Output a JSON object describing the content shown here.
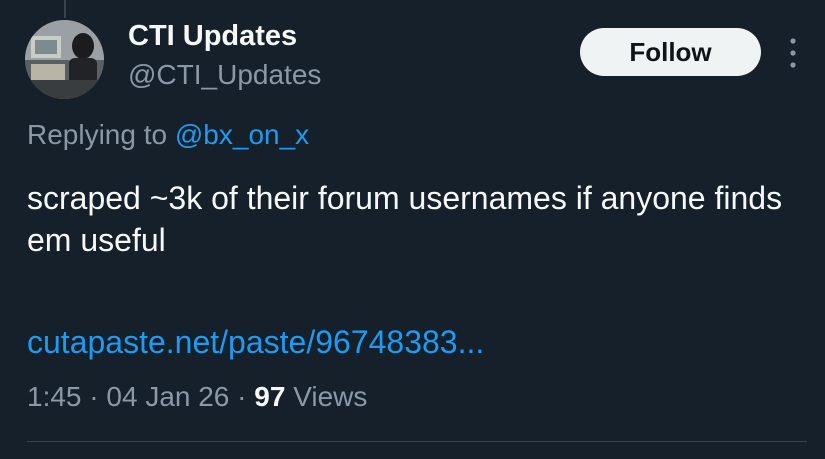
{
  "user": {
    "display_name": "CTI Updates",
    "handle": "@CTI_Updates",
    "avatar_icon": "avatar-image"
  },
  "actions": {
    "follow_label": "Follow",
    "more_icon": "more-vertical-icon"
  },
  "reply": {
    "prefix": "Replying to",
    "target": "@bx_on_x"
  },
  "tweet": {
    "text": "scraped ~3k of their forum usernames if anyone finds em useful",
    "link": "cutapaste.net/paste/96748383..."
  },
  "meta": {
    "time": "1:45",
    "date": "04 Jan 26",
    "separator": "·",
    "views_count": "97",
    "views_label": "Views"
  },
  "colors": {
    "background": "#15202b",
    "text_primary": "#f7f9f9",
    "text_secondary": "#8b98a5",
    "accent_link": "#1d9bf0",
    "divider": "#38444d",
    "follow_bg": "#eff3f4"
  }
}
